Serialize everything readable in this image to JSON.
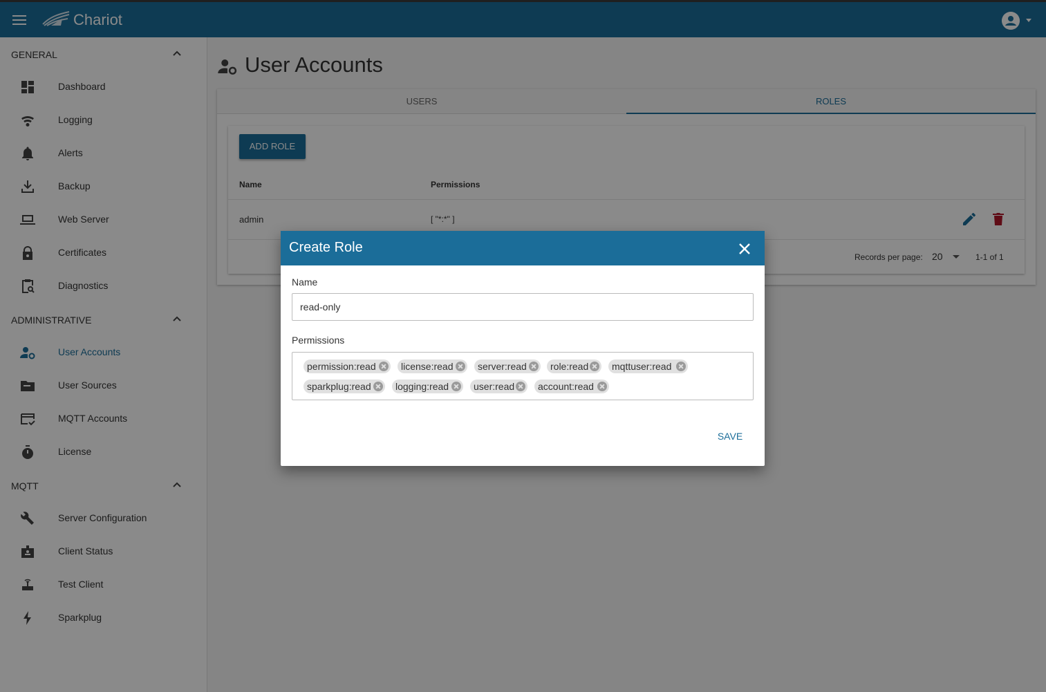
{
  "app": {
    "brand": "Chariot"
  },
  "sidebar": {
    "sections": [
      {
        "title": "GENERAL",
        "items": [
          "Dashboard",
          "Logging",
          "Alerts",
          "Backup",
          "Web Server",
          "Certificates",
          "Diagnostics"
        ]
      },
      {
        "title": "ADMINISTRATIVE",
        "items": [
          "User Accounts",
          "User Sources",
          "MQTT Accounts",
          "License"
        ]
      },
      {
        "title": "MQTT",
        "items": [
          "Server Configuration",
          "Client Status",
          "Test Client",
          "Sparkplug"
        ]
      }
    ],
    "active": "User Accounts"
  },
  "page": {
    "title": "User Accounts",
    "tabs": [
      "USERS",
      "ROLES"
    ],
    "active_tab": "ROLES",
    "add_button": "ADD ROLE",
    "table": {
      "headers": [
        "Name",
        "Permissions"
      ],
      "rows": [
        {
          "name": "admin",
          "permissions": "[ \"*:*\" ]"
        }
      ]
    },
    "pager": {
      "label": "Records per page:",
      "per_page": "20",
      "range": "1-1 of 1"
    }
  },
  "dialog": {
    "title": "Create Role",
    "name_label": "Name",
    "name_value": "read-only",
    "permissions_label": "Permissions",
    "permissions": [
      "permission:read",
      "license:read",
      "server:read",
      "role:read",
      "mqttuser:read",
      "sparkplug:read",
      "logging:read",
      "user:read",
      "account:read"
    ],
    "save_label": "SAVE"
  },
  "colors": {
    "primary": "#1b6d99",
    "delete": "#b0172a",
    "overlay": "rgba(0,0,0,0.46)"
  }
}
